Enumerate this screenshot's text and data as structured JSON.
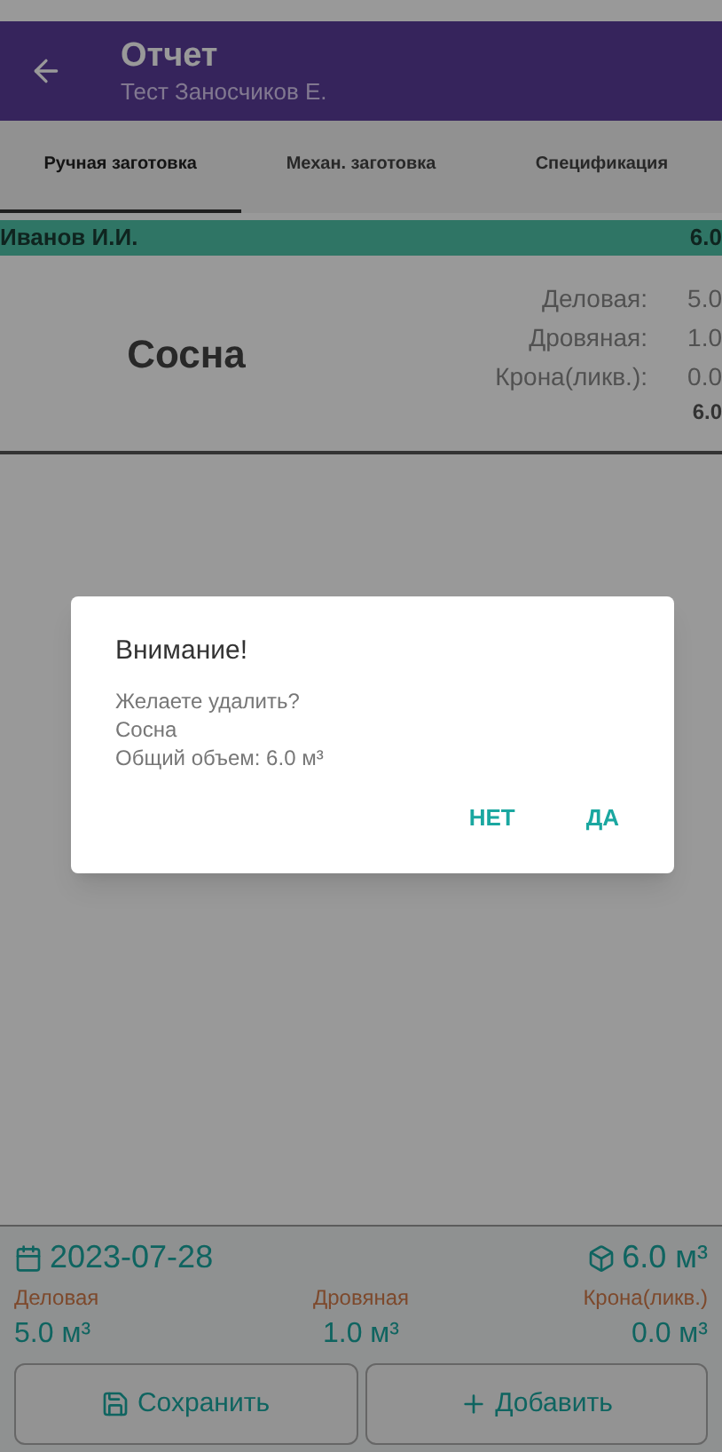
{
  "app_bar": {
    "title": "Отчет",
    "subtitle": "Тест Заносчиков Е."
  },
  "tabs": [
    {
      "label": "Ручная заготовка",
      "selected": true
    },
    {
      "label": "Механ. заготовка",
      "selected": false
    },
    {
      "label": "Спецификация",
      "selected": false
    }
  ],
  "group": {
    "name": "Иванов И.И.",
    "total": "6.0"
  },
  "item": {
    "species": "Сосна",
    "rows": [
      {
        "label": "Деловая:",
        "value": "5.0"
      },
      {
        "label": "Дровяная:",
        "value": "1.0"
      },
      {
        "label": "Крона(ликв.):",
        "value": "0.0"
      }
    ],
    "total": "6.0"
  },
  "footer": {
    "date": "2023-07-28",
    "total": "6.0 м³",
    "columns": [
      {
        "label": "Деловая",
        "value": "5.0 м³"
      },
      {
        "label": "Дровяная",
        "value": "1.0 м³"
      },
      {
        "label": "Крона(ликв.)",
        "value": "0.0 м³"
      }
    ]
  },
  "buttons": [
    {
      "kind": "save",
      "label": "Сохранить"
    },
    {
      "kind": "add",
      "label": "Добавить"
    }
  ],
  "dialog": {
    "title": "Внимание!",
    "lines": [
      "Желаете удалить?",
      "Сосна",
      "Общий объем: 6.0 м³"
    ],
    "actions": [
      "НЕТ",
      "ДА"
    ]
  }
}
